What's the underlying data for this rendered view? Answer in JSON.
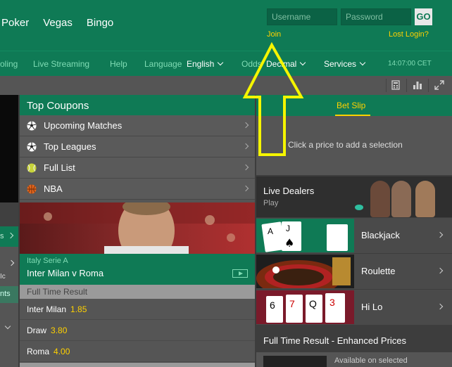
{
  "header": {
    "nav": [
      "Poker",
      "Vegas",
      "Bingo"
    ],
    "username_placeholder": "Username",
    "password_placeholder": "Password",
    "go_label": "GO",
    "join_label": "Join",
    "lost_login_label": "Lost Login?"
  },
  "subnav": {
    "cut_item": "oling",
    "live_streaming": "Live Streaming",
    "help": "Help",
    "language_label": "Language",
    "language_value": "English",
    "odds_label": "Odds",
    "odds_value": "Decimal",
    "services": "Services",
    "time": "14:07:00 CET"
  },
  "leftcol": {
    "frag1": "s",
    "frag2": "Ic",
    "frag3": "nts"
  },
  "coupons": {
    "title": "Top Coupons",
    "items": [
      {
        "label": "Upcoming Matches",
        "icon": "soccer-ball-icon"
      },
      {
        "label": "Top Leagues",
        "icon": "soccer-ball-icon"
      },
      {
        "label": "Full List",
        "icon": "tennis-ball-icon"
      },
      {
        "label": "NBA",
        "icon": "basketball-icon"
      }
    ],
    "league": "Italy Serie A",
    "match": "Inter Milan v Roma",
    "market": "Full Time Result",
    "selections": [
      {
        "name": "Inter Milan",
        "odds": "1.85"
      },
      {
        "name": "Draw",
        "odds": "3.80"
      },
      {
        "name": "Roma",
        "odds": "4.00"
      }
    ]
  },
  "betslip": {
    "title": "Bet Slip",
    "empty_text": "Click a price to add a selection"
  },
  "casino": {
    "live_title": "Live Dealers",
    "live_sub": "Play",
    "games": [
      "Blackjack",
      "Roulette",
      "Hi Lo"
    ]
  },
  "enhanced": {
    "title": "Full Time Result - Enhanced Prices",
    "text": "Available on selected"
  },
  "colors": {
    "brand_green": "#0f7a55",
    "accent_yellow": "#ffd100",
    "arrow_yellow": "#f5f500"
  }
}
